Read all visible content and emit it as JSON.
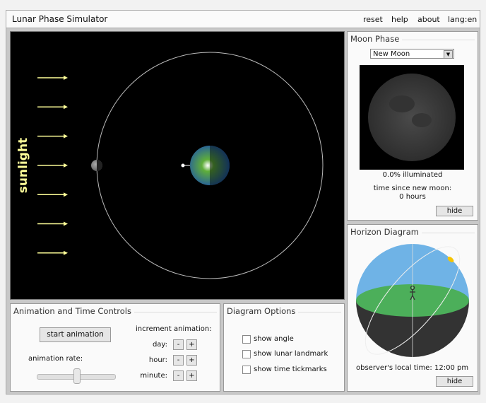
{
  "app": {
    "title": "Lunar Phase Simulator",
    "nav": [
      "reset",
      "help",
      "about",
      "lang:en"
    ]
  },
  "orbit_view": {
    "sunlight_label": "sunlight",
    "sunlight_color": "#ffff99",
    "arrow_count": 7
  },
  "moon_phase": {
    "title": "Moon Phase",
    "selected_phase": "New Moon",
    "illuminated": "0.0% illuminated",
    "time_label": "time since new moon:",
    "time_value": "0 hours",
    "hide_label": "hide"
  },
  "horizon": {
    "title": "Horizon Diagram",
    "local_time_label": "observer's local time:",
    "local_time_value": "12:00 pm",
    "hide_label": "hide",
    "sky_color": "#6fb3e6",
    "ground_color": "#4caf5a"
  },
  "animation": {
    "title": "Animation and Time Controls",
    "start_label": "start animation",
    "rate_label": "animation rate:",
    "rate_value": 0.5,
    "increment_label": "increment animation:",
    "rows": [
      {
        "label": "day:"
      },
      {
        "label": "hour:"
      },
      {
        "label": "minute:"
      }
    ],
    "minus": "-",
    "plus": "+"
  },
  "options": {
    "title": "Diagram Options",
    "items": [
      {
        "label": "show angle",
        "checked": false
      },
      {
        "label": "show lunar landmark",
        "checked": false
      },
      {
        "label": "show time tickmarks",
        "checked": false
      }
    ]
  }
}
